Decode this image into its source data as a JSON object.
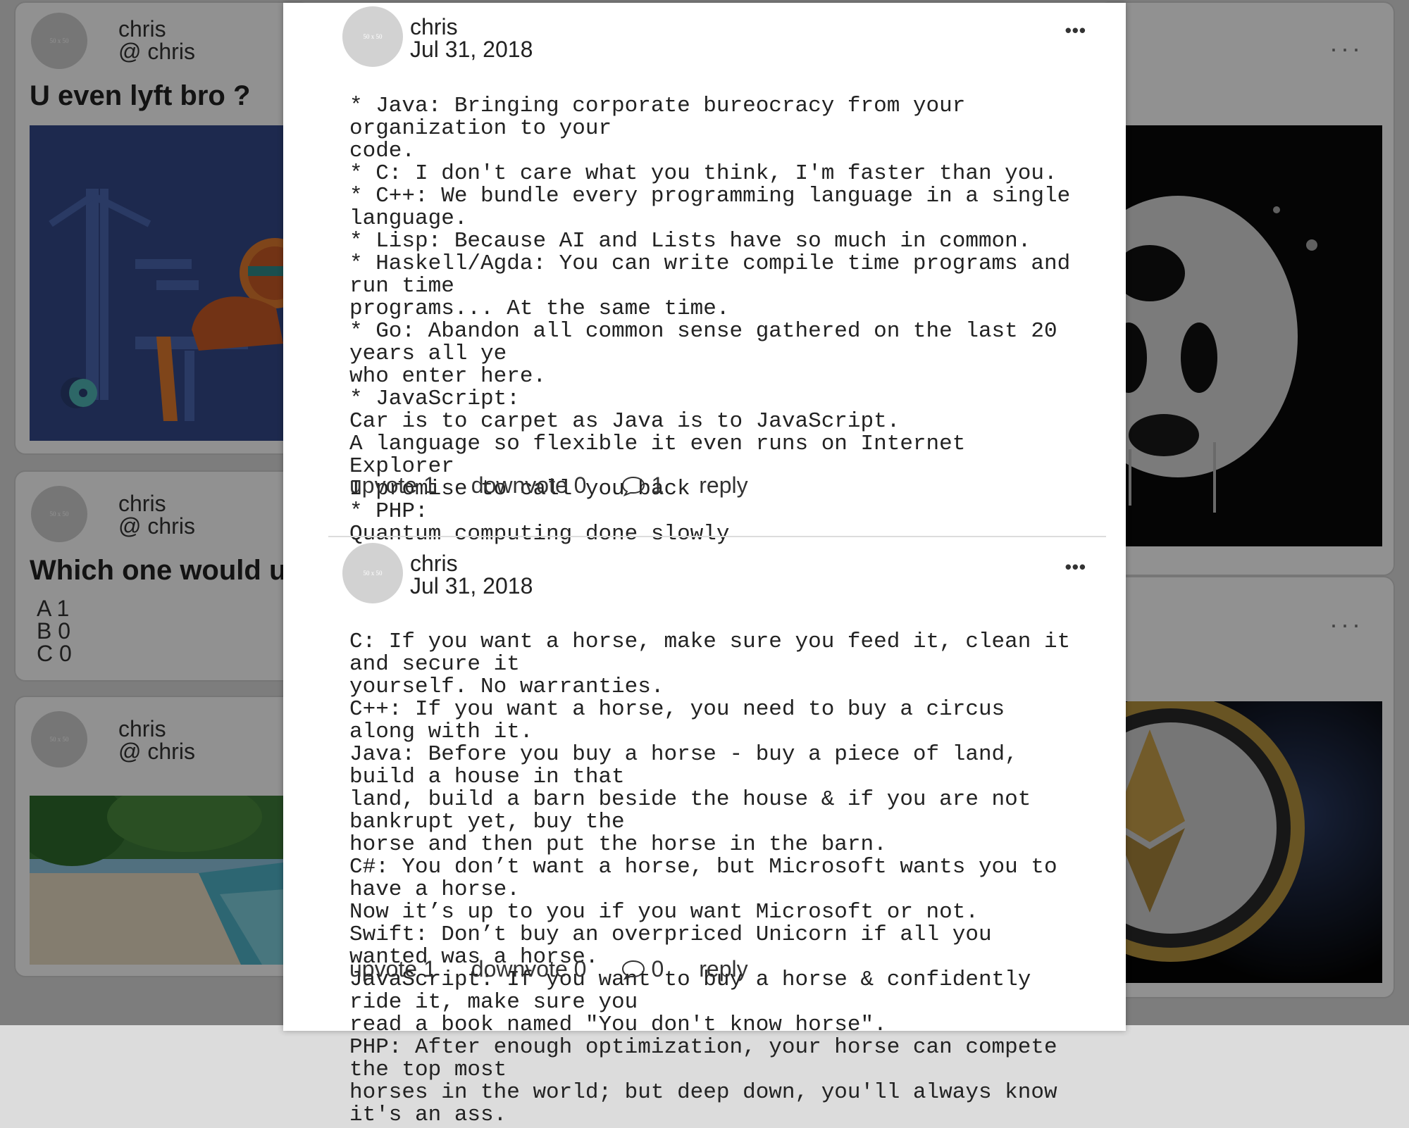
{
  "background_posts": [
    {
      "username": "chris",
      "handle": "@ chris",
      "title": "U even lyft bro ?",
      "avatar_text": "50 x 50",
      "menu": "...",
      "image_icon": "gym-illustration"
    },
    {
      "username": "chris",
      "handle": "@ chris",
      "title": "Which one would u",
      "avatar_text": "50 x 50",
      "menu": "...",
      "poll": [
        "A 1",
        "B 0",
        "C 0"
      ]
    },
    {
      "username": "chris",
      "handle": "@ chris",
      "avatar_text": "50 x 50",
      "image_icon": "beach-photo"
    }
  ],
  "right_images": [
    "panda-splash-photo",
    "ethereum-coin-photo"
  ],
  "modal": {
    "posts": [
      {
        "username": "chris",
        "date": "Jul 31, 2018",
        "avatar_text": "50 x 50",
        "more": "•••",
        "body": "* Java: Bringing corporate bureocracy from your organization to your\ncode.\n* C: I don't care what you think, I'm faster than you.\n* C++: We bundle every programming language in a single language.\n* Lisp: Because AI and Lists have so much in common.\n* Haskell/Agda: You can write compile time programs and run time\nprograms... At the same time.\n* Go: Abandon all common sense gathered on the last 20 years all ye\nwho enter here.\n* JavaScript:\nCar is to carpet as Java is to JavaScript.\nA language so flexible it even runs on Internet Explorer\nI promise to call you back\n* PHP:\nQuantum computing done slowly",
        "upvote": "upvote 1",
        "downvote": "downvote 0",
        "comments": "1",
        "reply": "reply"
      },
      {
        "username": "chris",
        "date": "Jul 31, 2018",
        "avatar_text": "50 x 50",
        "more": "•••",
        "body": "C: If you want a horse, make sure you feed it, clean it and secure it\nyourself. No warranties.\nC++: If you want a horse, you need to buy a circus along with it.\nJava: Before you buy a horse - buy a piece of land, build a house in that\nland, build a barn beside the house & if you are not bankrupt yet, buy the\nhorse and then put the horse in the barn.\nC#: You don’t want a horse, but Microsoft wants you to have a horse.\nNow it’s up to you if you want Microsoft or not.\nSwift: Don’t buy an overpriced Unicorn if all you wanted was a horse.\nJavaScript: If you want to buy a horse & confidently ride it, make sure you\nread a book named \"You don't know horse\".\nPHP: After enough optimization, your horse can compete the top most\nhorses in the world; but deep down, you'll always know it's an ass.",
        "upvote": "upvote 1",
        "downvote": "downvote 0",
        "comments": "0",
        "reply": "reply"
      }
    ]
  }
}
